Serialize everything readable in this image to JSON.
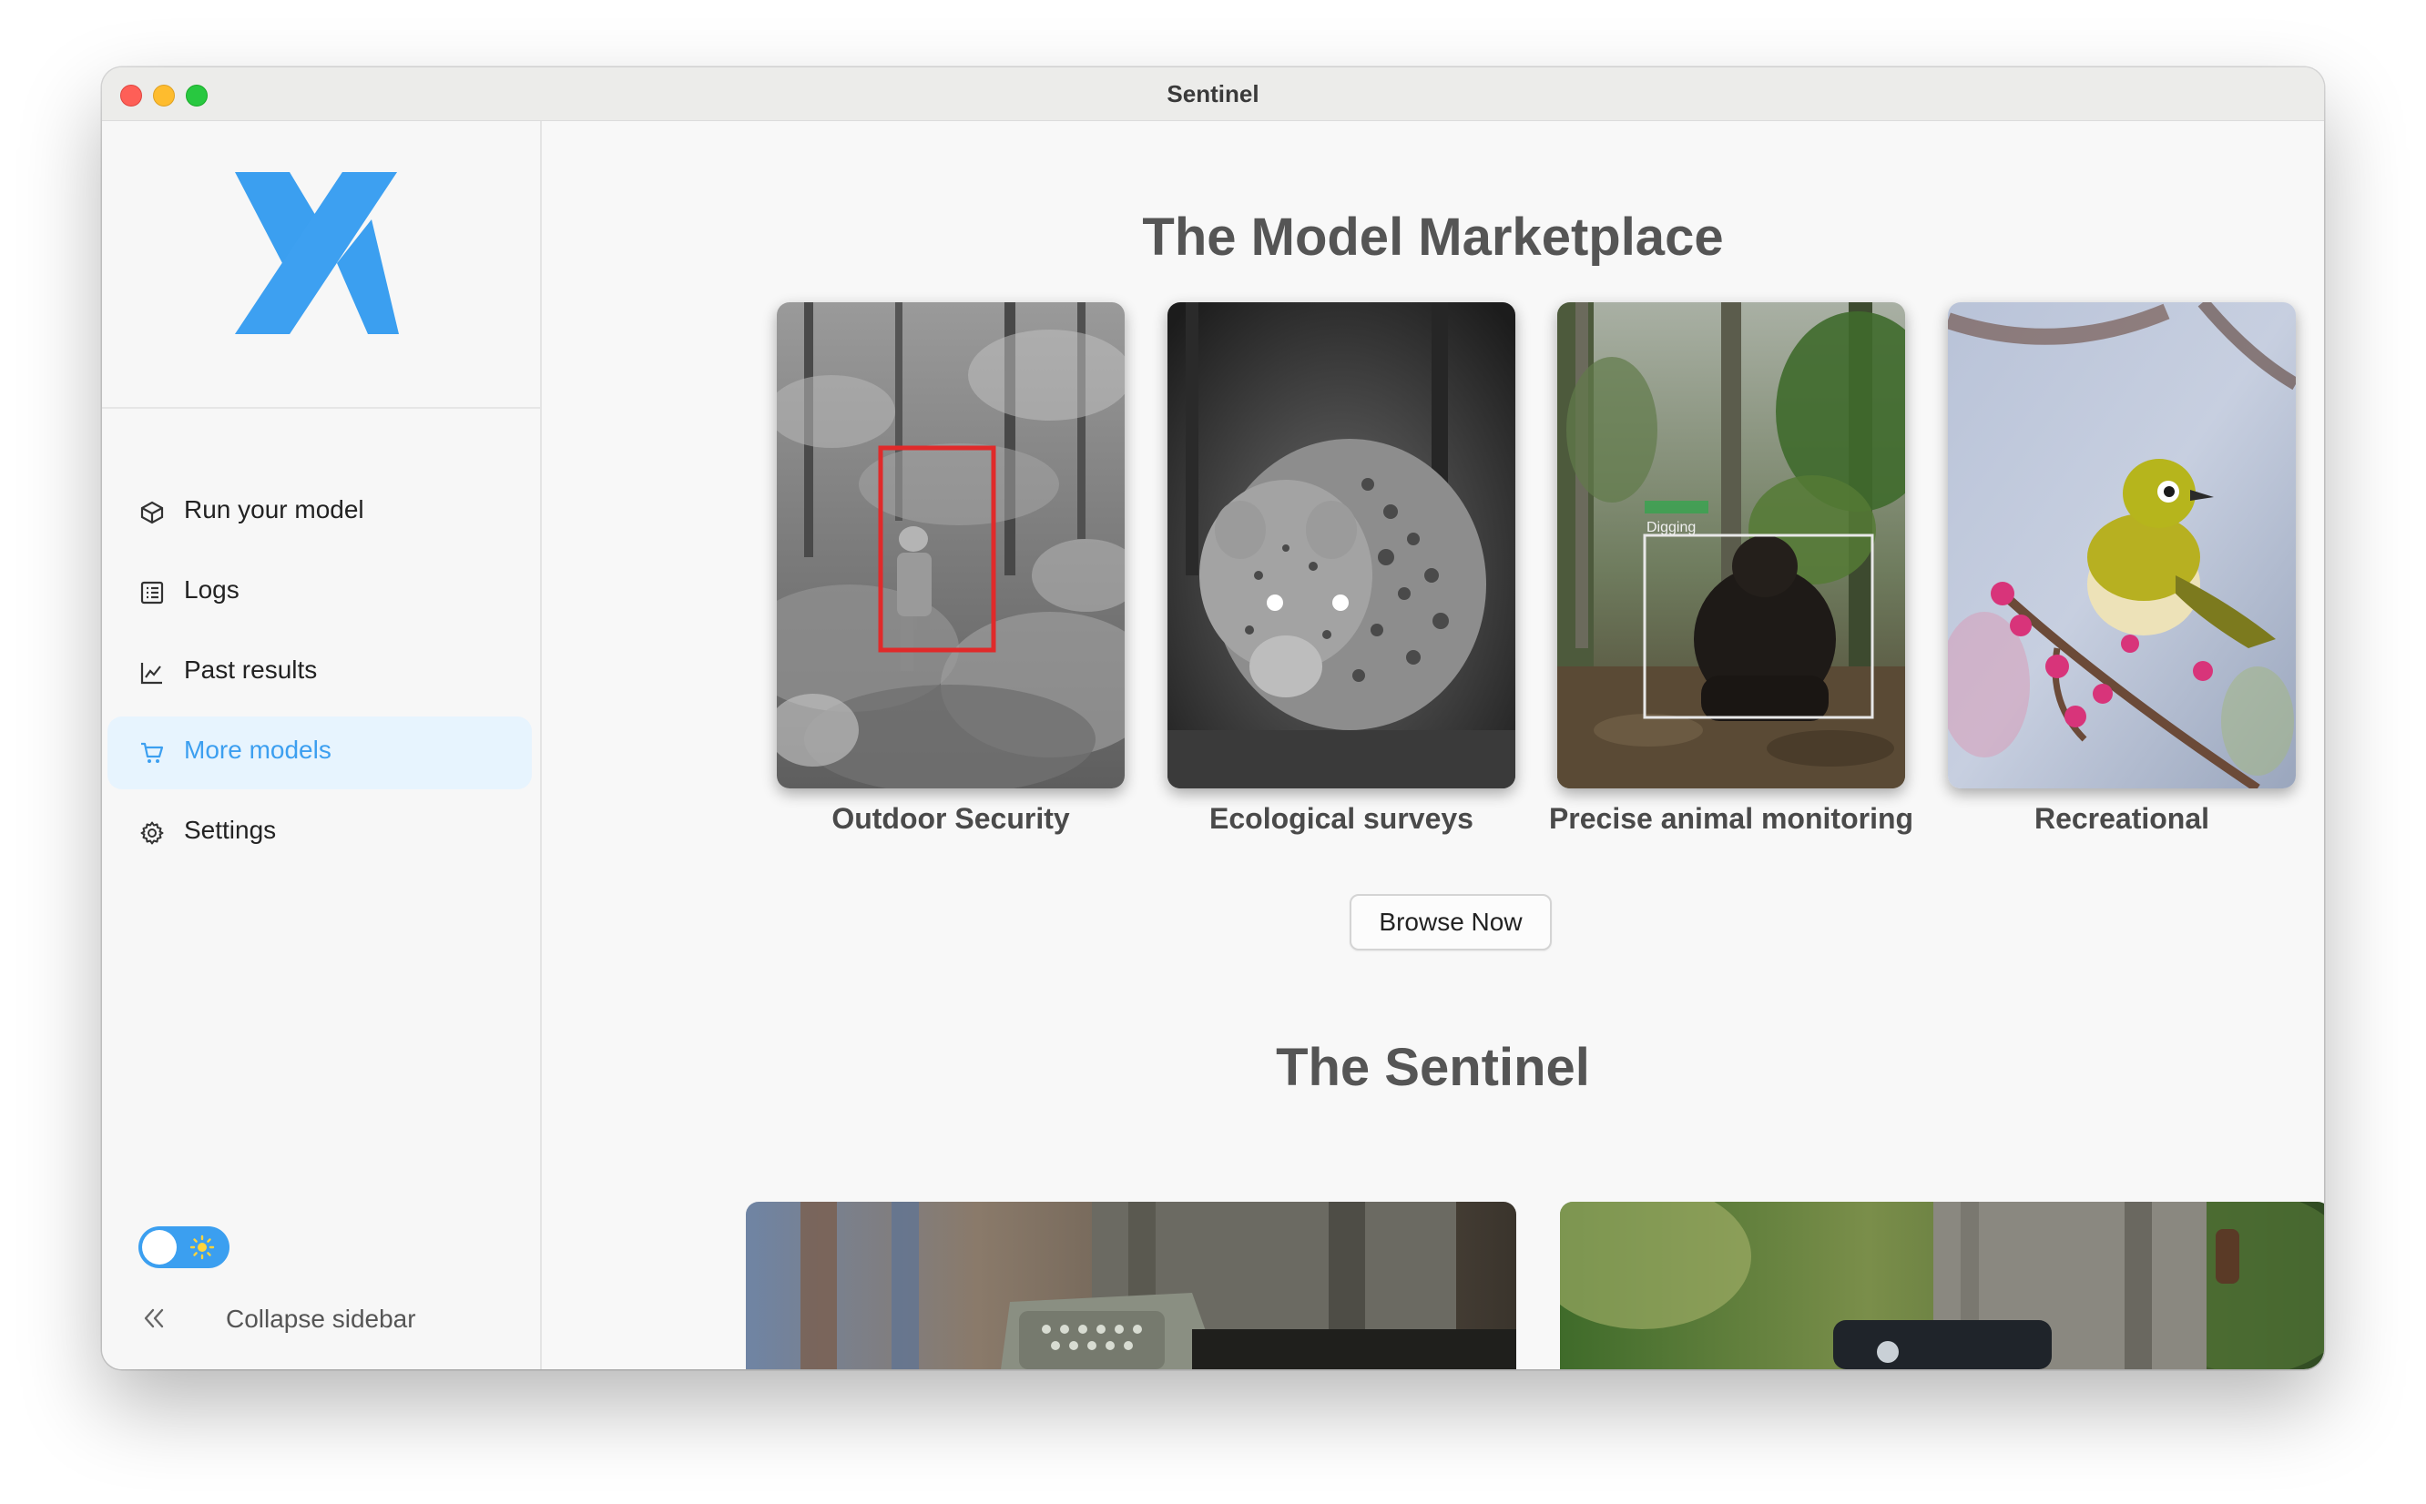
{
  "window": {
    "title": "Sentinel"
  },
  "sidebar": {
    "logo_icon": "x-logo-icon",
    "items": [
      {
        "label": "Run your model",
        "icon": "cube-icon",
        "active": false
      },
      {
        "label": "Logs",
        "icon": "list-icon",
        "active": false
      },
      {
        "label": "Past results",
        "icon": "chart-line-icon",
        "active": false
      },
      {
        "label": "More models",
        "icon": "cart-icon",
        "active": true
      },
      {
        "label": "Settings",
        "icon": "gear-icon",
        "active": false
      }
    ],
    "theme_toggle": {
      "state": "light",
      "icon": "sun-icon"
    },
    "collapse_label": "Collapse sidebar"
  },
  "main": {
    "marketplace": {
      "title": "The Model Marketplace",
      "cards": [
        {
          "caption": "Outdoor Security",
          "image": "grayscale forest with person in red detection box"
        },
        {
          "caption": "Ecological surveys",
          "image": "night camera-trap jaguar"
        },
        {
          "caption": "Precise animal monitoring",
          "image": "forest gorilla with detection box"
        },
        {
          "caption": "Recreational",
          "image": "yellow-green bird on blossoming branch"
        }
      ],
      "overlay_label": "Digging",
      "button_label": "Browse Now"
    },
    "sentinel": {
      "title": "The Sentinel"
    }
  },
  "colors": {
    "accent": "#3b9ff0",
    "active_bg": "#e7f4fe",
    "detection_red": "#e02a2a",
    "heading": "#555555"
  }
}
